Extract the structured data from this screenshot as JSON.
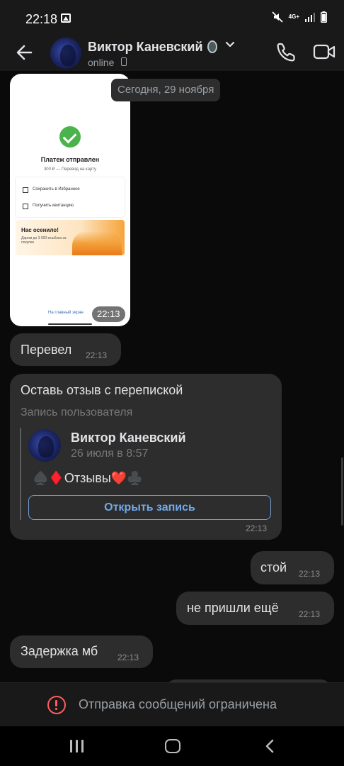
{
  "status_bar": {
    "time": "22:18",
    "network_label": "4G+"
  },
  "header": {
    "contact_name": "Виктор Каневский",
    "contact_status": "online"
  },
  "chat": {
    "photo_message": {
      "title": "Платеж отправлен",
      "subtitle": "300 ₽ — Перевод на карту",
      "row_1": "Сохранить в Избранное",
      "row_2": "Получить квитанцию",
      "banner_title": "Нас осенило!",
      "banner_text": "Дарим до 3 600 кешбэка за покупки",
      "link": "На главный экран",
      "time": "22:13"
    },
    "date_separator": "Сегодня, 29 ноября",
    "messages": [
      {
        "text": "Перевел",
        "time": "22:13",
        "direction": "incoming"
      },
      {
        "text": "стой",
        "time": "22:13",
        "direction": "outgoing"
      },
      {
        "text": "не пришли ещё",
        "time": "22:13",
        "direction": "outgoing"
      },
      {
        "text": "Задержка мб",
        "time": "22:13",
        "direction": "incoming"
      }
    ],
    "post_message": {
      "text": "Оставь отзыв с перепиской",
      "label": "Запись пользователя",
      "author": "Виктор Каневский",
      "date": "26 июля в 8:57",
      "content": "♠️♦️Отзывы❤️♣️",
      "button": "Открыть запись",
      "time": "22:13"
    }
  },
  "composer": {
    "notice": "Отправка сообщений ограничена"
  },
  "colors": {
    "background": "#0a0a0a",
    "bar": "#191919",
    "bubble": "#2d2d2d",
    "accent": "#71aaeb",
    "alert": "#ff5c5c"
  },
  "icons": [
    "back-arrow-icon",
    "call-icon",
    "video-call-icon",
    "chevron-down-icon",
    "alert-icon",
    "nav-recents-icon",
    "nav-home-icon",
    "nav-back-icon"
  ]
}
